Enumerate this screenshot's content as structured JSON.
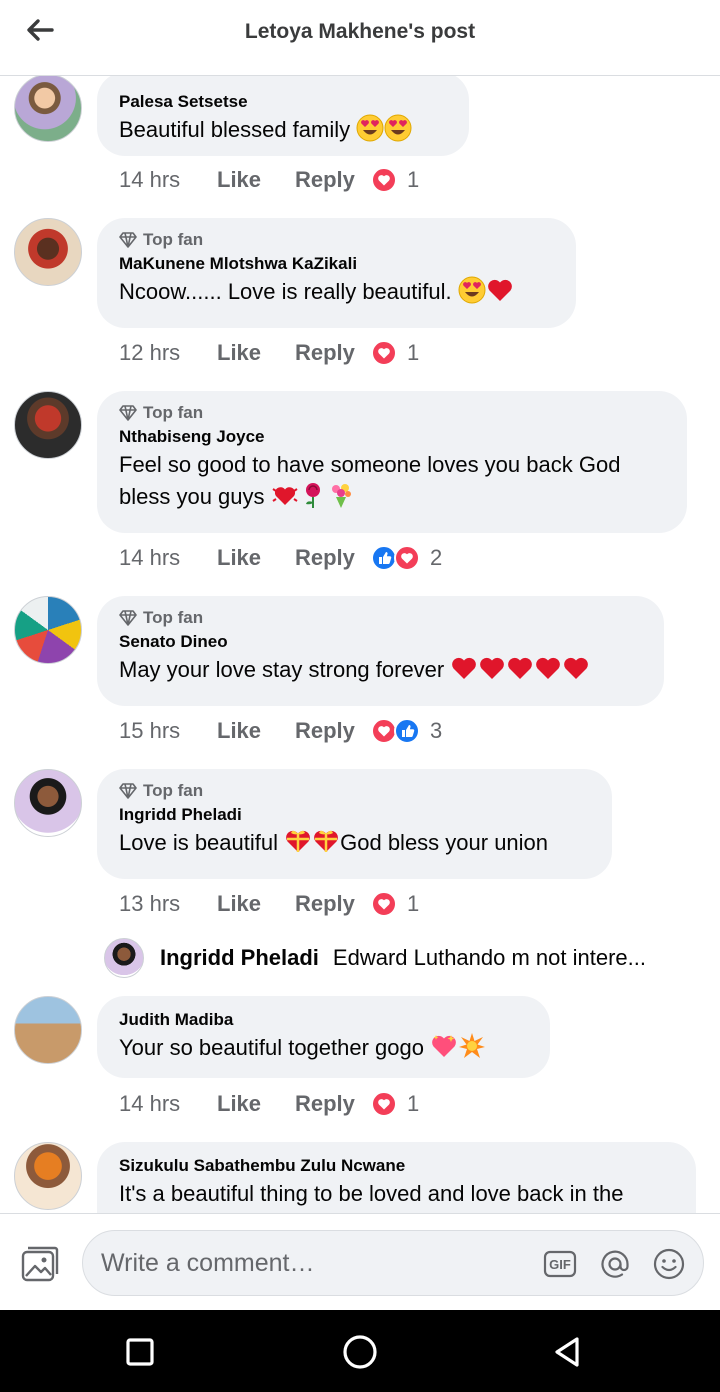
{
  "header": {
    "title": "Letoya Makhene's post",
    "back_icon": "arrow-left-icon"
  },
  "actions": {
    "like": "Like",
    "reply": "Reply"
  },
  "badge_label": "Top fan",
  "comments": [
    {
      "author": "Palesa Setsetse",
      "top_fan": false,
      "text": "Beautiful blessed family",
      "emoji": [
        "heart-eyes",
        "heart-eyes"
      ],
      "time": "14 hrs",
      "reactions": [
        "love"
      ],
      "count": "1"
    },
    {
      "author": "MaKunene Mlotshwa KaZikali",
      "top_fan": true,
      "text": "Ncoow...... Love is really beautiful.",
      "emoji": [
        "heart-eyes",
        "red-heart"
      ],
      "time": "12 hrs",
      "reactions": [
        "love"
      ],
      "count": "1"
    },
    {
      "author": "Nthabiseng Joyce",
      "top_fan": true,
      "text_line1": "Feel so good to have someone loves you back God",
      "text_line2": "bless you guys",
      "emoji": [
        "beating-heart",
        "rose",
        "bouquet"
      ],
      "time": "14 hrs",
      "reactions": [
        "like",
        "love"
      ],
      "count": "2"
    },
    {
      "author": "Senato Dineo",
      "top_fan": true,
      "text": "May your love stay strong forever",
      "emoji": [
        "red-heart",
        "red-heart",
        "red-heart",
        "red-heart",
        "red-heart"
      ],
      "time": "15 hrs",
      "reactions": [
        "love",
        "like"
      ],
      "count": "3"
    },
    {
      "author": "Ingridd Pheladi",
      "top_fan": true,
      "text_before": "Love is beautiful",
      "text_after": "God bless your union",
      "emoji": [
        "heart-ribbon",
        "heart-ribbon"
      ],
      "time": "13 hrs",
      "reactions": [
        "love"
      ],
      "count": "1"
    },
    {
      "author": "Judith Madiba",
      "top_fan": false,
      "text": "Your so beautiful together gogo",
      "emoji": [
        "sparkling-heart",
        "collision"
      ],
      "time": "14 hrs",
      "reactions": [
        "love"
      ],
      "count": "1"
    },
    {
      "author": "Sizukulu Sabathembu Zulu Ncwane",
      "top_fan": false,
      "text": "It's a beautiful thing to be loved and love back in the"
    }
  ],
  "reply_preview": {
    "author": "Ingridd Pheladi",
    "text": "Edward Luthando m not intere..."
  },
  "composer": {
    "placeholder": "Write a comment…",
    "gif_label": "GIF"
  },
  "colors": {
    "love": "#f33e58",
    "like": "#1877f2",
    "bubble": "#f0f2f5",
    "meta": "#65676b"
  }
}
